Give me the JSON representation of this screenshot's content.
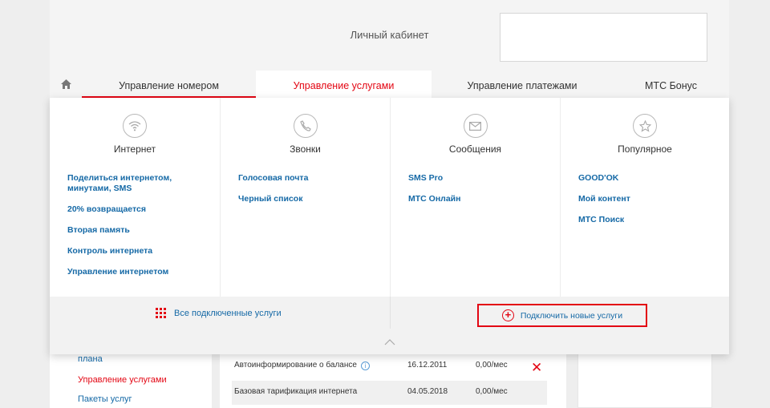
{
  "header": {
    "title": "Личный кабинет"
  },
  "nav": {
    "home_icon": "home-icon",
    "items": [
      {
        "label": "Управление номером"
      },
      {
        "label": "Управление услугами"
      },
      {
        "label": "Управление платежами"
      },
      {
        "label": "МТС Бонус"
      }
    ],
    "active_color": "#e30613"
  },
  "dropdown": {
    "columns": [
      {
        "icon": "wifi-icon",
        "title": "Интернет",
        "links": [
          "Поделиться интернетом, минутами, SMS",
          "20% возвращается",
          "Вторая память",
          "Контроль интернета",
          "Управление интернетом"
        ]
      },
      {
        "icon": "phone-icon",
        "title": "Звонки",
        "links": [
          "Голосовая почта",
          "Черный список"
        ]
      },
      {
        "icon": "envelope-icon",
        "title": "Сообщения",
        "links": [
          "SMS Pro",
          "МТС Онлайн"
        ]
      },
      {
        "icon": "star-icon",
        "title": "Популярное",
        "links": [
          "GOOD'OK",
          "Мой контент",
          "МТС Поиск"
        ]
      }
    ],
    "footer": {
      "all_services": "Все подключенные услуги",
      "connect_new": "Подключить новые услуги"
    }
  },
  "sidebar": {
    "items": [
      "плана",
      "Управление услугами",
      "Пакеты услуг"
    ]
  },
  "services_table": {
    "rows": [
      {
        "name": "Автоинформирование о балансе",
        "date": "16.12.2011",
        "price": "0,00/мес"
      },
      {
        "name": "Базовая тарификация интернета",
        "date": "04.05.2018",
        "price": "0,00/мес"
      }
    ]
  },
  "colors": {
    "link": "#1569a6",
    "accent": "#e30613"
  }
}
